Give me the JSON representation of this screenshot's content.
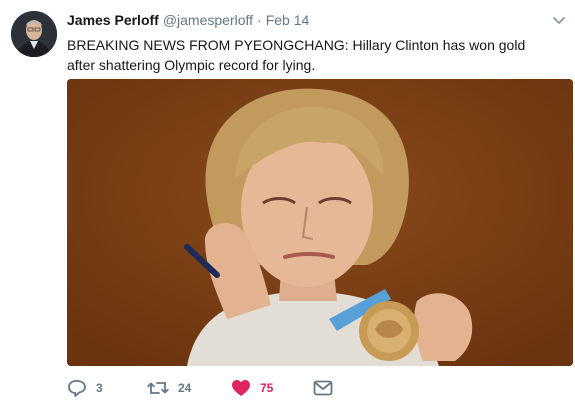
{
  "tweet": {
    "author_name": "James Perloff",
    "author_handle": "@jamesperloff",
    "separator": "·",
    "timestamp": "Feb 14",
    "text": "BREAKING NEWS FROM PYEONGCHANG: Hillary Clinton has won gold after shattering Olympic record for lying."
  },
  "actions": {
    "reply_count": "3",
    "retweet_count": "24",
    "like_count": "75",
    "liked": true
  },
  "icons": {
    "reply": "reply-icon",
    "retweet": "retweet-icon",
    "like": "heart-icon",
    "message": "envelope-icon",
    "menu": "chevron-down-icon"
  },
  "colors": {
    "like_active": "#e0245e",
    "secondary_text": "#657786",
    "primary_text": "#14171a"
  }
}
